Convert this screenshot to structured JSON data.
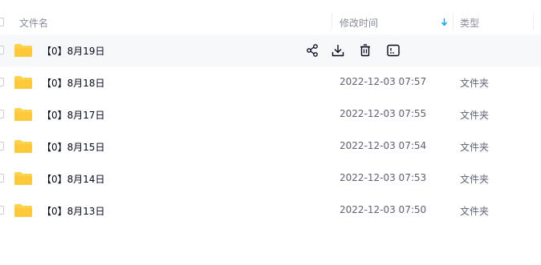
{
  "header": {
    "name_label": "文件名",
    "time_label": "修改时间",
    "type_label": "类型"
  },
  "files": [
    {
      "name": "【0】8月19日",
      "time": "",
      "type": ""
    },
    {
      "name": "【0】8月18日",
      "time": "2022-12-03 07:57",
      "type": "文件夹"
    },
    {
      "name": "【0】8月17日",
      "time": "2022-12-03 07:55",
      "type": "文件夹"
    },
    {
      "name": "【0】8月15日",
      "time": "2022-12-03 07:54",
      "type": "文件夹"
    },
    {
      "name": "【0】8月14日",
      "time": "2022-12-03 07:53",
      "type": "文件夹"
    },
    {
      "name": "【0】8月13日",
      "time": "2022-12-03 07:50",
      "type": "文件夹"
    }
  ],
  "hover_actions": [
    "share-icon",
    "download-icon",
    "delete-icon",
    "more-icon"
  ],
  "colors": {
    "folder": "#ffd24d",
    "sort_arrow": "#06a7ff",
    "hover_row": "#f7f8fa"
  }
}
